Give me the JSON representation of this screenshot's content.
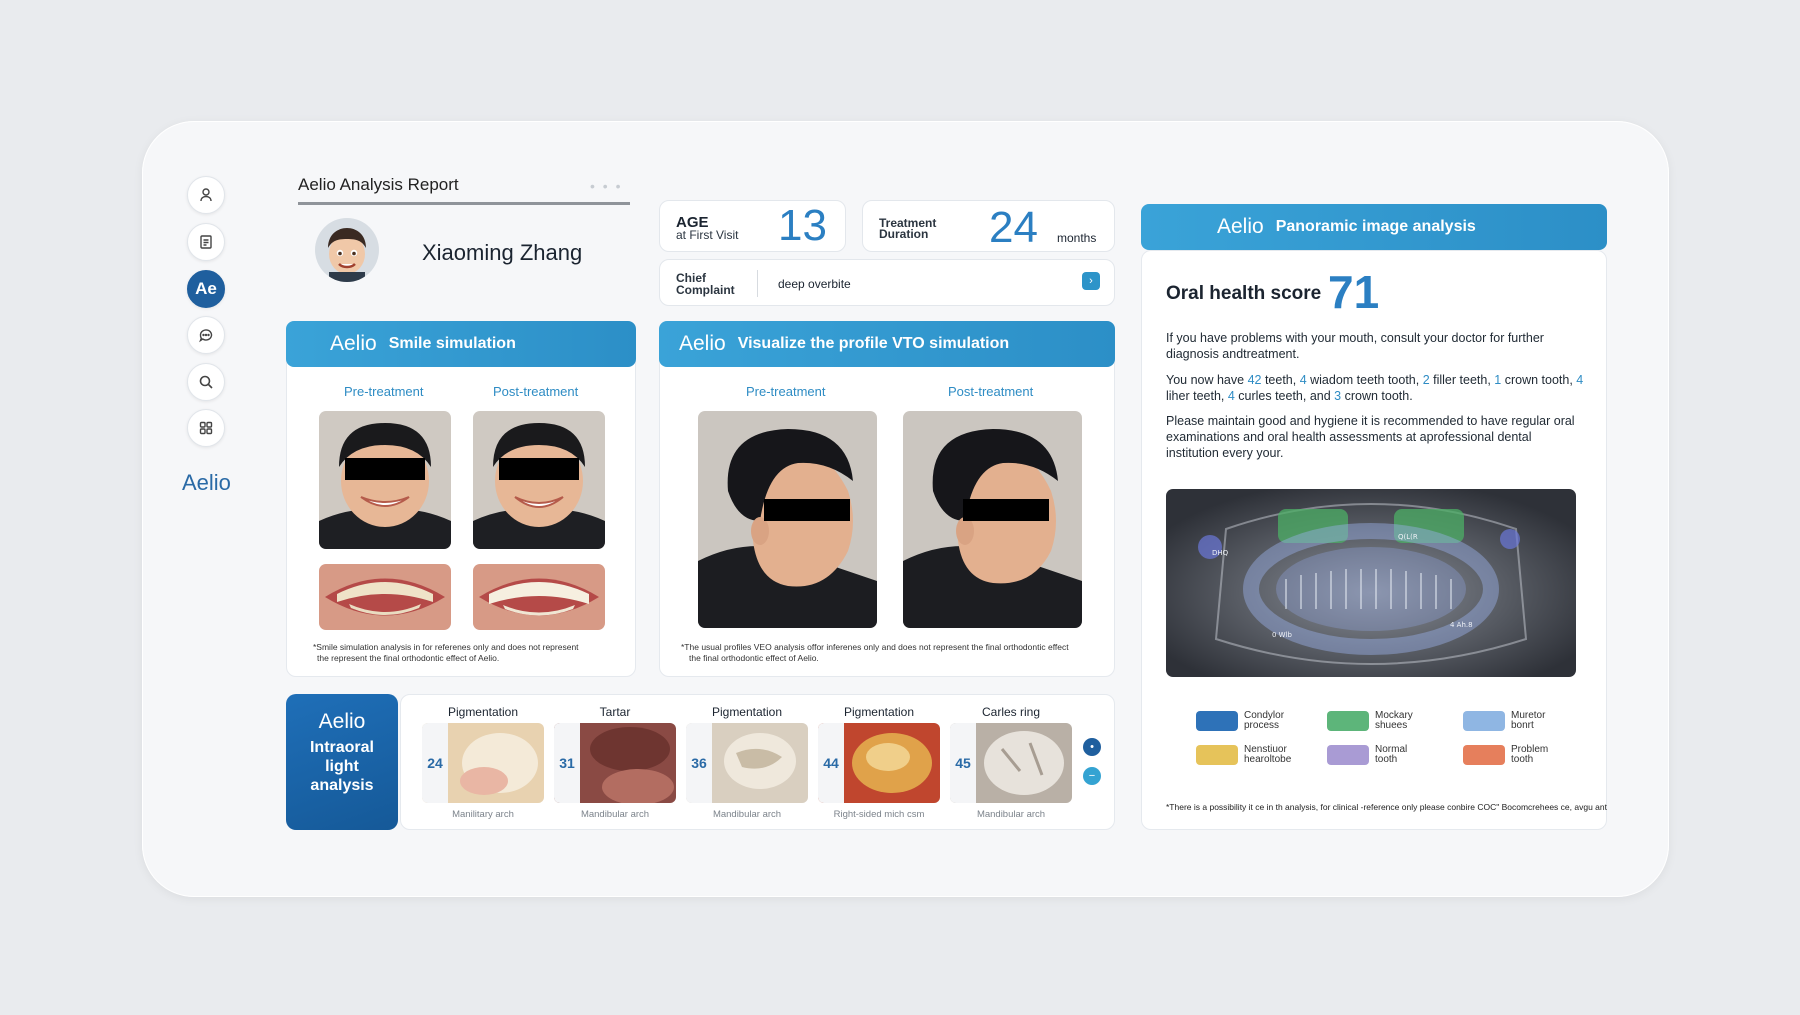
{
  "sidebar": {
    "icons": [
      "person-icon",
      "document-icon",
      "aelio-logo",
      "chat-icon",
      "search-icon",
      "grid-icon"
    ],
    "active_label": "Ae",
    "brand": "Aelio"
  },
  "header": {
    "title": "Aelio Analysis Report",
    "dots": "• • •",
    "patient_name": "Xiaoming Zhang"
  },
  "stats": {
    "age_label_1": "AGE",
    "age_label_2": "at First Visit",
    "age_value": "13",
    "duration_label_1": "Treatment",
    "duration_label_2": "Duration",
    "duration_value": "24",
    "duration_unit": "months",
    "chief_label_1": "Chief",
    "chief_label_2": "Complaint",
    "chief_value": "deep overbite",
    "chief_button": "›"
  },
  "smile": {
    "brand": "Aelio",
    "title": "Smile simulation",
    "pre": "Pre-treatment",
    "post": "Post-treatment",
    "footnote_1": "*Smile simulation analysis in for referenes only and does not represent",
    "footnote_2": "the represent the final orthodontic effect of Aelio."
  },
  "vto": {
    "brand": "Aelio",
    "title": "Visualize the profile VTO simulation",
    "pre": "Pre-treatment",
    "post": "Post-treatment",
    "footnote_1": "*The usual profiles VEO analysis offor inferenes only and does not represent the final orthodontic effect",
    "footnote_2": "the final orthodontic effect of Aelio."
  },
  "intraoral": {
    "brand": "Aelio",
    "title_1": "Intraoral",
    "title_2": "light",
    "title_3": "analysis",
    "items": [
      {
        "label": "Pigmentation",
        "num": "24",
        "sub": "Manilitary arch",
        "color": "#e8d2b0"
      },
      {
        "label": "Tartar",
        "num": "31",
        "sub": "Mandibular arch",
        "color": "#8a4a44"
      },
      {
        "label": "Pigmentation",
        "num": "36",
        "sub": "Mandibular arch",
        "color": "#d9cfc0"
      },
      {
        "label": "Pigmentation",
        "num": "44",
        "sub": "Right-sided mich csm",
        "color": "#e0a24a"
      },
      {
        "label": "Carles ring",
        "num": "45",
        "sub": "Mandibular arch",
        "color": "#dcd6ce"
      }
    ],
    "nav_prev": "•",
    "nav_next": "−"
  },
  "panoramic": {
    "brand": "Aelio",
    "title": "Panoramic image analysis",
    "score_label": "Oral health score",
    "score_value": "71",
    "p1": "If you have problems with your mouth, consult your doctor for further diagnosis andtreatment.",
    "p2_a": "You now have ",
    "p2_n1": "42",
    "p2_b": " teeth, ",
    "p2_n2": "4",
    "p2_c": " wiadom teeth tooth, ",
    "p2_n3": "2",
    "p2_d": " filler teeth, ",
    "p2_n4": "1",
    "p2_e": " crown tooth, ",
    "p2_n5": "4",
    "p2_f": " liher teeth, ",
    "p2_n6": "4",
    "p2_g": " curles teeth, and ",
    "p2_n7": "3",
    "p2_h": " crown tooth.",
    "p3": "Please maintain good and hygiene it is recommended to have regular oral examinations and oral health assessments at aprofessional dental institution every your.",
    "xray_labels": [
      "DHQ",
      "Q(L(R",
      "0 Wlb",
      "4 Ah.8"
    ],
    "legend": [
      {
        "l1": "Condylor",
        "l2": "process",
        "color": "#2e72b8"
      },
      {
        "l1": "Mockary",
        "l2": "shuees",
        "color": "#5db57a"
      },
      {
        "l1": "Muretor",
        "l2": "bonrt",
        "color": "#8fb6e3"
      },
      {
        "l1": "Nenstiuor",
        "l2": "hearoltobe",
        "color": "#e6c35a"
      },
      {
        "l1": "Normal",
        "l2": "tooth",
        "color": "#a99bd4"
      },
      {
        "l1": "Problem",
        "l2": "tooth",
        "color": "#e67f5c"
      }
    ],
    "disclaimer": "*There is a possibility it ce in th analysis, for clinical -reference only please conbire COC\" Bocomcrehees ce, avgu ant"
  }
}
